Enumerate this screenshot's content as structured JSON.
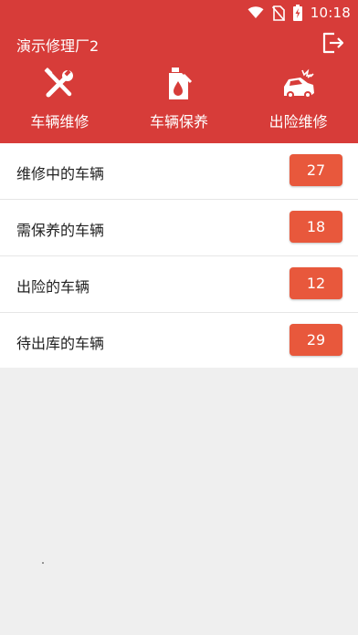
{
  "status": {
    "time": "10:18"
  },
  "appbar": {
    "title": "演示修理厂2"
  },
  "nav": [
    {
      "label": "车辆维修",
      "icon": "wrench-screwdriver-icon"
    },
    {
      "label": "车辆保养",
      "icon": "oil-bottle-icon"
    },
    {
      "label": "出险维修",
      "icon": "car-crash-icon"
    }
  ],
  "list": [
    {
      "label": "维修中的车辆",
      "count": "27"
    },
    {
      "label": "需保养的车辆",
      "count": "18"
    },
    {
      "label": "出险的车辆",
      "count": "12"
    },
    {
      "label": "待出库的车辆",
      "count": "29"
    }
  ],
  "colors": {
    "header": "#d73c39",
    "badge": "#e8583c",
    "background": "#efefef"
  }
}
